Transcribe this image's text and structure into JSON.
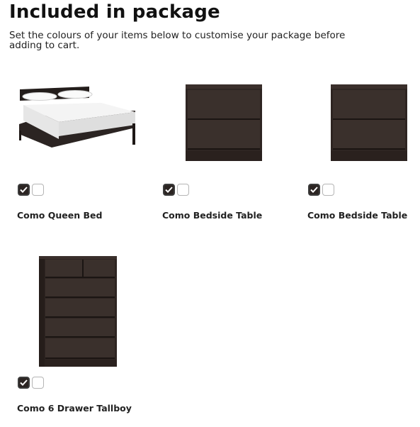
{
  "page": {
    "title": "Included in package",
    "subtitle": "Set the colours of your items below to customise your package before adding to cart."
  },
  "items": [
    {
      "name": "Como Queen Bed",
      "image": "queen-bed-image",
      "swatches": [
        {
          "color": "#2b2422",
          "selected": true
        },
        {
          "color": "#ffffff",
          "selected": false
        }
      ]
    },
    {
      "name": "Como Bedside Table",
      "image": "bedside-table-image",
      "swatches": [
        {
          "color": "#2b2422",
          "selected": true
        },
        {
          "color": "#ffffff",
          "selected": false
        }
      ]
    },
    {
      "name": "Como Bedside Table",
      "image": "bedside-table-image",
      "swatches": [
        {
          "color": "#2b2422",
          "selected": true
        },
        {
          "color": "#ffffff",
          "selected": false
        }
      ]
    },
    {
      "name": "Como 6 Drawer Tallboy",
      "image": "tallboy-image",
      "swatches": [
        {
          "color": "#2b2422",
          "selected": true
        },
        {
          "color": "#ffffff",
          "selected": false
        }
      ]
    }
  ],
  "colors": {
    "wood_dark": "#2b2422",
    "check": "#ffffff"
  },
  "icons": {
    "selected": "checkmark-icon"
  }
}
